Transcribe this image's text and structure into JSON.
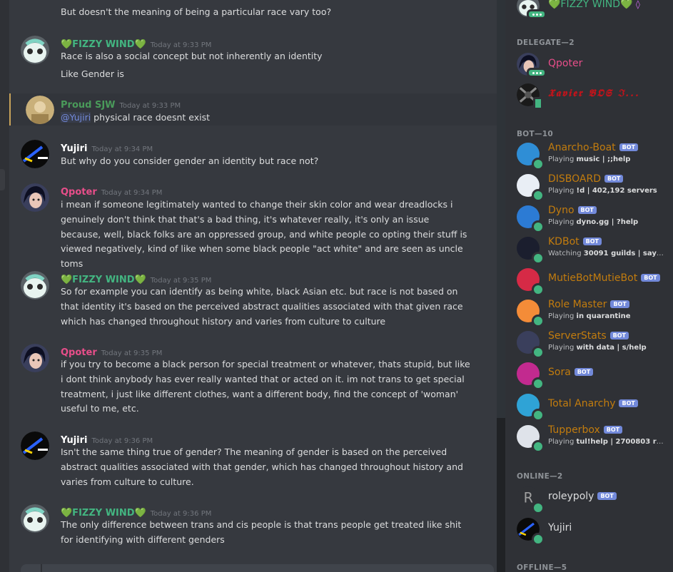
{
  "chat": {
    "top_fragment": "But doesn't the meaning of being a particular race vary too?",
    "messages": [
      {
        "author": "💚FIZZY WIND💚",
        "ts": "Today at 9:33 PM",
        "lines": [
          "Race is also a social concept but not inherently an identity",
          "Like Gender is"
        ]
      },
      {
        "author": "Proud SJW",
        "ts": "Today at 9:33 PM",
        "mention": "@Yujiri",
        "text": " physical race doesnt exist"
      },
      {
        "author": "Yujiri",
        "ts": "Today at 9:34 PM",
        "text": "But why do you consider gender an identity but race not?"
      },
      {
        "author": "Qpoter",
        "ts": "Today at 9:34 PM",
        "text": "i mean if someone legitimately wanted to change their skin color and wear dreadlocks i genuinely don't think that that's a bad thing, it's whatever really, it's only an issue because, well, black folks are an oppressed group, and white people co opting their stuff is viewed negatively, kind of like when some black people \"act white\" and are seen as uncle toms"
      },
      {
        "author": "💚FIZZY WIND💚",
        "ts": "Today at 9:35 PM",
        "text": "So for example you can identify as being white, black Asian etc. but race is not based on that identity it's based on the perceived abstract qualities associated with that given race which has changed throughout history and varies from culture to culture"
      },
      {
        "author": "Qpoter",
        "ts": "Today at 9:35 PM",
        "text": "if you try to become a black person for special treatment or whatever, thats stupid, but like i dont think anybody has ever really wanted that or acted on it. im not trans to get special treatment, i just like different clothes, want a different body, find the concept of 'woman' useful to me, etc."
      },
      {
        "author": "Yujiri",
        "ts": "Today at 9:36 PM",
        "text": "Isn't the same thing true of gender? The meaning of gender is based on the perceived abstract qualities associated with that gender, which has changed throughout history and varies from culture to culture."
      },
      {
        "author": "💚FIZZY WIND💚",
        "ts": "Today at 9:36 PM",
        "text": "The only difference between trans and cis people is that trans people get treated like shit for identifying with different genders"
      }
    ]
  },
  "members": {
    "top_member": {
      "name": "💚FIZZY WIND💚",
      "badge": "◊"
    },
    "sections": {
      "delegate": "DELEGATE—2",
      "bot": "BOT—10",
      "online": "ONLINE—2",
      "offline": "OFFLINE—5"
    },
    "delegate": [
      {
        "name": "Qpoter"
      },
      {
        "name": "𝖃𝖆𝖛𝖎𝖊𝖗 𝕭𝕺𝕾 ℑ..."
      }
    ],
    "bot_tag": "BOT",
    "bots": [
      {
        "name": "Anarcho-Boat",
        "verb": "Playing",
        "activity": "music | ;;help"
      },
      {
        "name": "DISBOARD",
        "verb": "Playing",
        "activity": "!d | 402,192 servers"
      },
      {
        "name": "Dyno",
        "verb": "Playing",
        "activity": "dyno.gg | ?help"
      },
      {
        "name": "KDBot",
        "verb": "Watching",
        "activity": "30091 guilds | say ..."
      },
      {
        "name": "MutieBotMutieBot",
        "verb": "",
        "activity": ""
      },
      {
        "name": "Role Master",
        "verb": "Playing",
        "activity": "in quarantine"
      },
      {
        "name": "ServerStats",
        "verb": "Playing",
        "activity": "with data | s/help"
      },
      {
        "name": "Sora",
        "verb": "",
        "activity": ""
      },
      {
        "name": "Total Anarchy",
        "verb": "",
        "activity": ""
      },
      {
        "name": "Tupperbox",
        "verb": "Playing",
        "activity": "tul!help | 2700803 reg..."
      }
    ],
    "online": [
      {
        "name": "roleypoly",
        "bot": true
      },
      {
        "name": "Yujiri",
        "bot": false
      }
    ]
  },
  "colors": {
    "fizzy": "#43b581",
    "proud": "#4a9a5a",
    "qpoter": "#e84e8a",
    "yujiri": "#ffffff",
    "bot_role": "#c27c0e",
    "xavier": "#c0141b"
  }
}
